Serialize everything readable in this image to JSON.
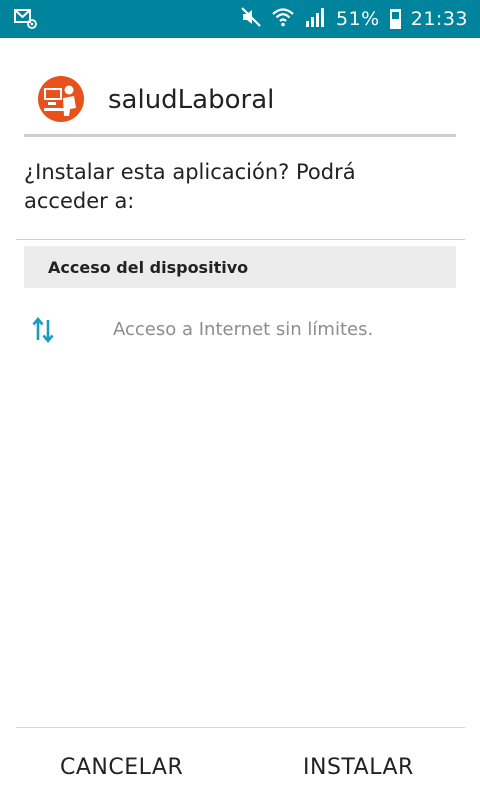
{
  "status_bar": {
    "notification_icon": "email-notification-icon",
    "mute_icon": "mute-icon",
    "wifi_icon": "wifi-icon",
    "signal_icon": "signal-icon",
    "battery_percent_text": "51%",
    "battery_level": 0.51,
    "time": "21:33"
  },
  "app": {
    "name": "saludLaboral",
    "icon": "app-logo-icon",
    "icon_color": "#e8501c"
  },
  "prompt": "¿Instalar esta aplicación? Podrá acceder a:",
  "permissions_section": {
    "title": "Acceso del dispositivo",
    "items": [
      {
        "icon": "data-transfer-icon",
        "label": "Acceso a Internet sin límites."
      }
    ]
  },
  "actions": {
    "cancel_label": "CANCELAR",
    "install_label": "INSTALAR"
  },
  "colors": {
    "status_bar": "#00849e",
    "accent": "#1a9cc1"
  }
}
